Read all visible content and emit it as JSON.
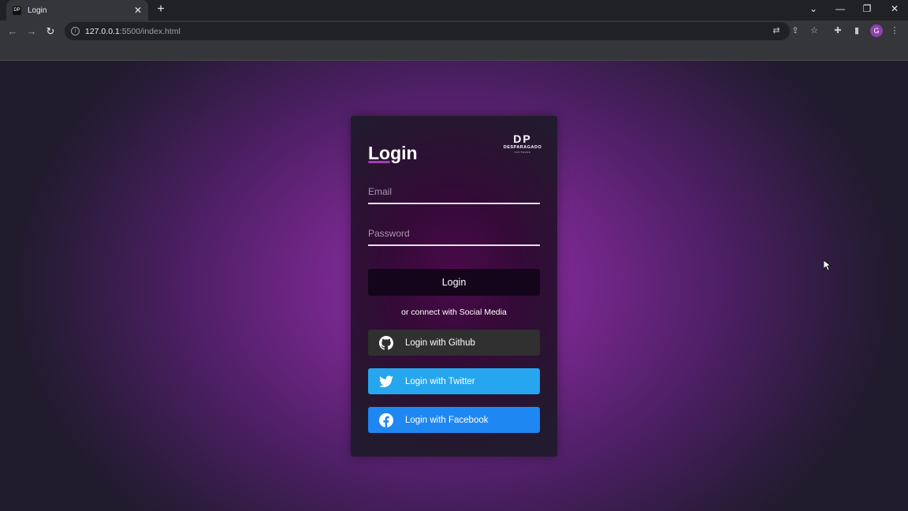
{
  "browser": {
    "tab_title": "Login",
    "tab_favicon_text": "DP",
    "tab_close": "✕",
    "new_tab": "+",
    "url_host": "127.0.0.1",
    "url_rest": ":5500/index.html",
    "avatar_letter": "G"
  },
  "login": {
    "title": "Login",
    "email_placeholder": "Email",
    "password_placeholder": "Password",
    "login_button": "Login",
    "social_text": "or connect with Social Media"
  },
  "logo": {
    "mark": "DP",
    "brand": "DESPARAGADO",
    "sub": "SOFTWARE"
  },
  "social": {
    "github_label": "Login with Github",
    "twitter_label": "Login with Twitter",
    "facebook_label": "Login with Facebook"
  },
  "colors": {
    "github": "#303030",
    "twitter": "#26a6ee",
    "facebook": "#1f87f2",
    "accent": "#a040b0"
  }
}
